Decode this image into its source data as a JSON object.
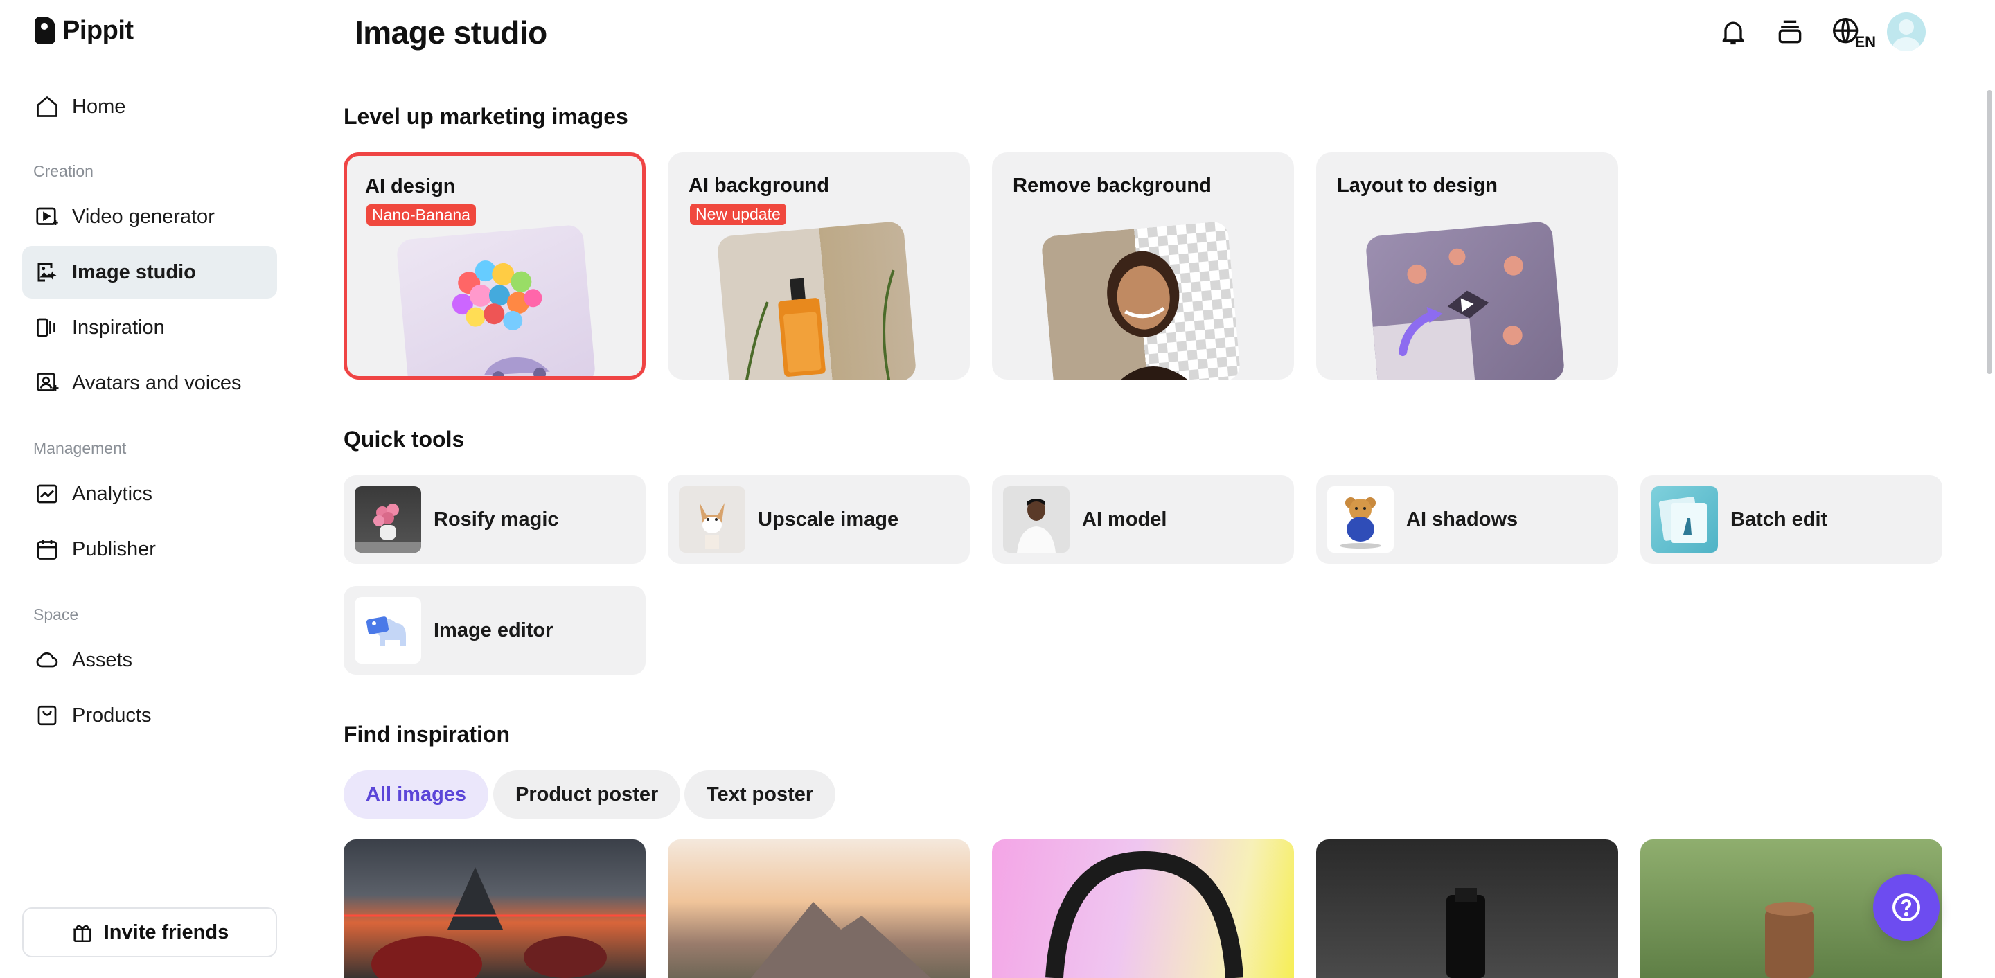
{
  "app": {
    "name": "Pippit"
  },
  "sidebar": {
    "items": [
      {
        "label": "Home",
        "icon": "home-icon"
      },
      {
        "label": "Video generator",
        "icon": "video-generator-icon"
      },
      {
        "label": "Image studio",
        "icon": "image-studio-icon",
        "active": true
      },
      {
        "label": "Inspiration",
        "icon": "inspiration-icon"
      },
      {
        "label": "Avatars and voices",
        "icon": "avatar-icon"
      },
      {
        "label": "Analytics",
        "icon": "analytics-icon"
      },
      {
        "label": "Publisher",
        "icon": "calendar-icon"
      },
      {
        "label": "Assets",
        "icon": "cloud-icon"
      },
      {
        "label": "Products",
        "icon": "bag-icon"
      }
    ],
    "sections": {
      "creation": "Creation",
      "management": "Management",
      "space": "Space"
    },
    "invite_label": "Invite friends"
  },
  "header": {
    "title": "Image studio",
    "language": "EN"
  },
  "marketing": {
    "title": "Level up marketing images",
    "cards": [
      {
        "title": "AI design",
        "badge": "Nano-Banana",
        "selected": true
      },
      {
        "title": "AI background",
        "badge": "New update"
      },
      {
        "title": "Remove background"
      },
      {
        "title": "Layout to design"
      }
    ]
  },
  "quick_tools": {
    "title": "Quick tools",
    "items": [
      {
        "label": "Rosify magic"
      },
      {
        "label": "Upscale image"
      },
      {
        "label": "AI model"
      },
      {
        "label": "AI shadows"
      },
      {
        "label": "Batch edit"
      },
      {
        "label": "Image editor"
      }
    ]
  },
  "inspiration": {
    "title": "Find inspiration",
    "filters": [
      {
        "label": "All images",
        "active": true
      },
      {
        "label": "Product poster"
      },
      {
        "label": "Text poster"
      }
    ]
  },
  "colors": {
    "accent": "#6d4cf0",
    "active_nav_bg": "#e9eef1",
    "selected_border": "#ef4444",
    "badge": "#f0483e"
  }
}
